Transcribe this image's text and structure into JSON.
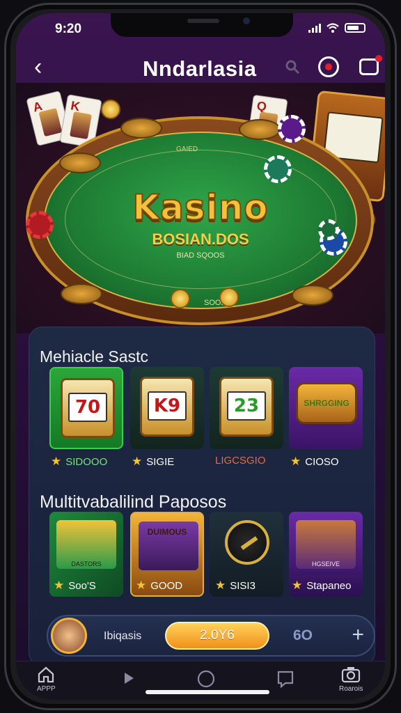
{
  "status_bar": {
    "time": "9:20"
  },
  "app_bar": {
    "title": "Nndarlasia"
  },
  "hero": {
    "felt_top_text": "GAIED",
    "logo_text": "Kasino",
    "subtitle": "BOSIAN.DOS",
    "sub_small": "BIAD SQOOS",
    "felt_bottom_text": "SOOD"
  },
  "section1": {
    "title": "Mehiacle Sastc",
    "tiles": [
      {
        "reel": "70",
        "label": "SIDOOO"
      },
      {
        "reel": "K9",
        "label": "SIGIE"
      },
      {
        "reel": "23",
        "label": "LIGCSGIO"
      },
      {
        "reel": "SHRGGING",
        "label": "CIOSO"
      }
    ]
  },
  "section2": {
    "title": "Multitvabalilind Paposos",
    "tiles": [
      {
        "caption": "DASTORS",
        "label": "Soo'S"
      },
      {
        "caption": "DUIMOUS",
        "label": "GOOD"
      },
      {
        "caption": "",
        "label": "SISI3"
      },
      {
        "caption": "HGSEIVE",
        "label": "Stapaneo"
      }
    ]
  },
  "player_bar": {
    "name": "Ibiqasis",
    "amount": "2.0Y6",
    "side_value": "6O"
  },
  "bottom_nav": {
    "left_label": "APPP",
    "right_label": "Roarois"
  },
  "colors": {
    "accent_gold": "#f3b43a",
    "felt_green": "#1d7a32",
    "bg_purple": "#2a0f3e"
  }
}
